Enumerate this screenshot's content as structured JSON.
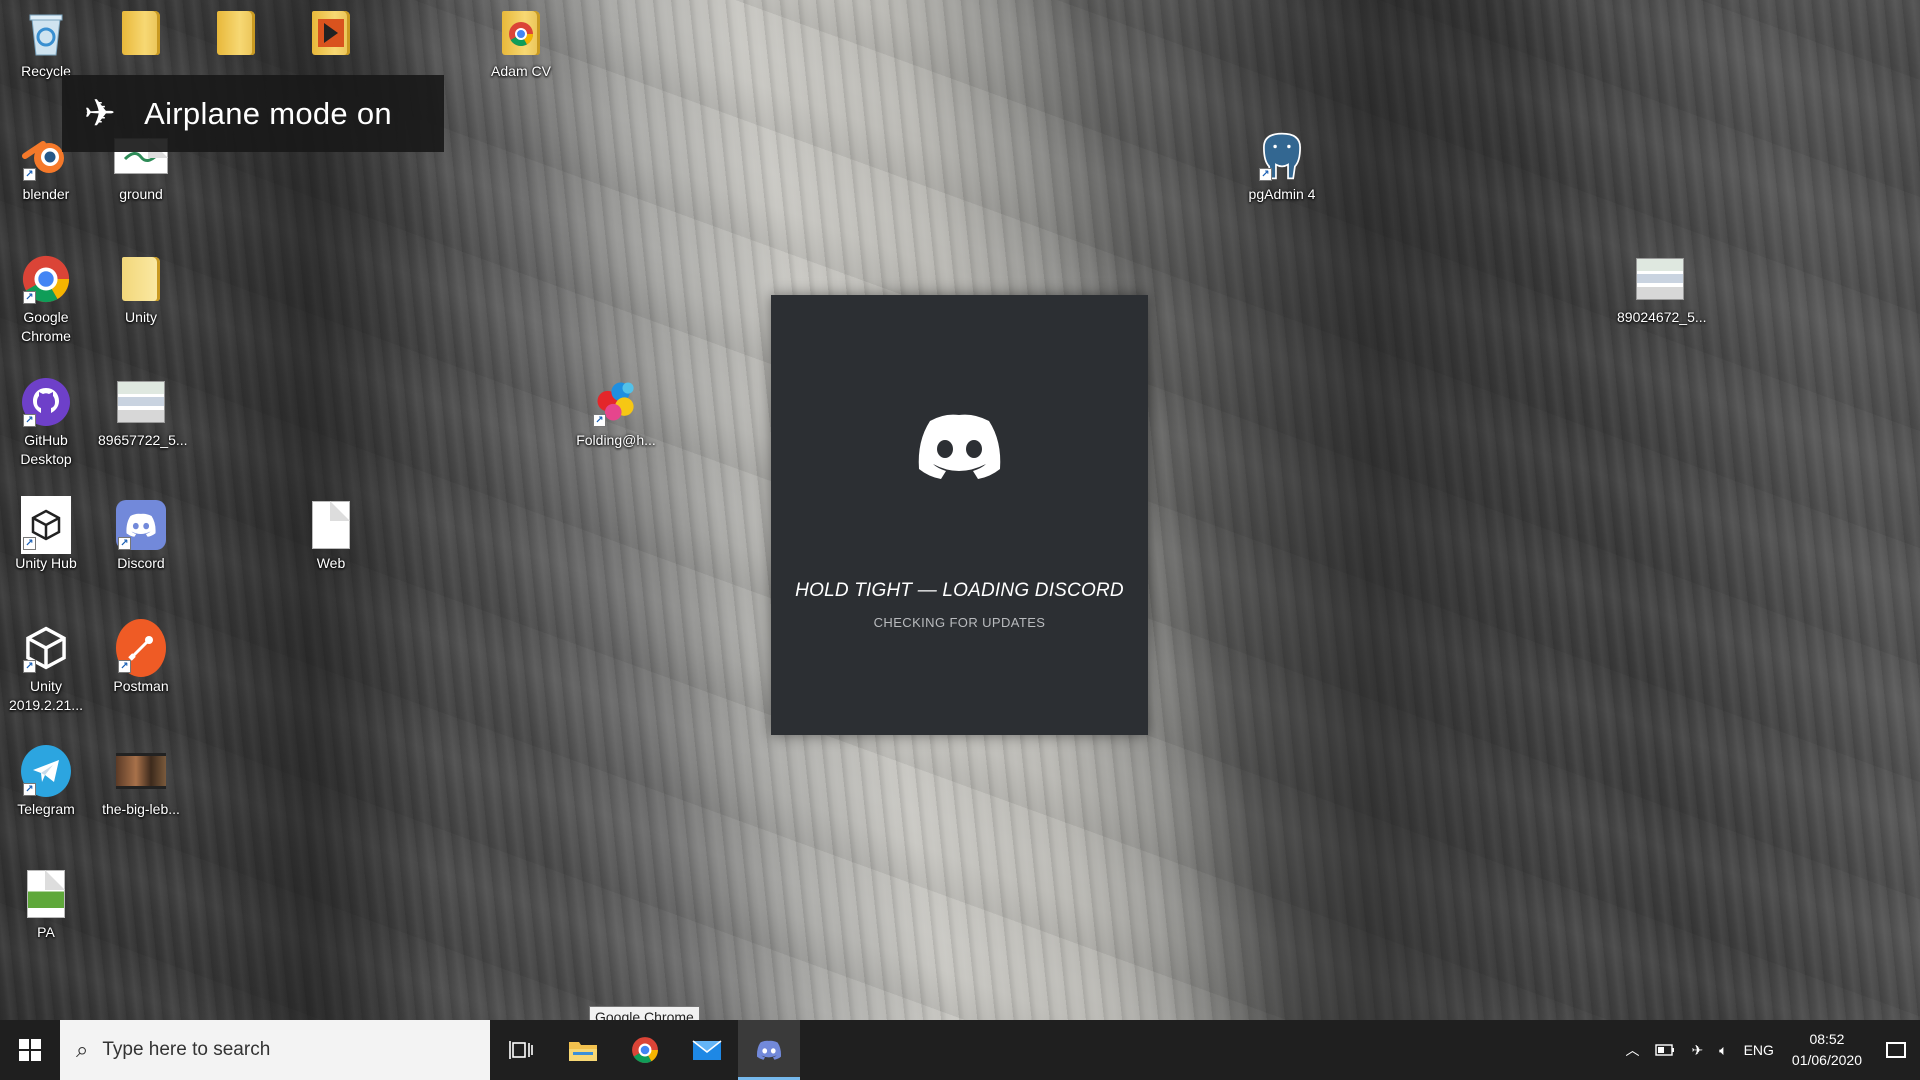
{
  "desktop": {
    "icons": [
      {
        "label": "Recycle",
        "icon": "recycle-bin-icon"
      },
      {
        "label": "",
        "icon": "folder-icon"
      },
      {
        "label": "",
        "icon": "folder-icon"
      },
      {
        "label": "",
        "icon": "folder-media-icon"
      },
      {
        "label": "Adam CV",
        "icon": "folder-chrome-icon"
      },
      {
        "label": "blender",
        "icon": "blender-icon"
      },
      {
        "label": "ground",
        "icon": "image-file-icon"
      },
      {
        "label": "pgAdmin 4",
        "icon": "pgadmin-elephant-icon"
      },
      {
        "label": "Google Chrome",
        "icon": "chrome-icon"
      },
      {
        "label": "Unity",
        "icon": "folder-icon"
      },
      {
        "label": "89024672_5...",
        "icon": "image-file-icon"
      },
      {
        "label": "GitHub Desktop",
        "icon": "github-icon"
      },
      {
        "label": "89657722_5...",
        "icon": "image-file-icon"
      },
      {
        "label": "Folding@h...",
        "icon": "folding-at-home-icon"
      },
      {
        "label": "Unity Hub",
        "icon": "unity-hub-icon"
      },
      {
        "label": "Discord",
        "icon": "discord-icon"
      },
      {
        "label": "Web",
        "icon": "blank-file-icon"
      },
      {
        "label": "Unity 2019.2.21...",
        "icon": "unity-icon"
      },
      {
        "label": "Postman",
        "icon": "postman-icon"
      },
      {
        "label": "Telegram",
        "icon": "telegram-icon"
      },
      {
        "label": "the-big-leb...",
        "icon": "video-file-icon"
      },
      {
        "label": "PA",
        "icon": "document-icon"
      }
    ]
  },
  "airplane_notification": {
    "text": "Airplane mode on",
    "icon": "airplane-icon"
  },
  "discord_splash": {
    "title": "HOLD TIGHT — LOADING DISCORD",
    "subtitle": "CHECKING FOR UPDATES",
    "background": "#2c2f33"
  },
  "tooltip": {
    "text": "Google Chrome"
  },
  "taskbar": {
    "search_placeholder": "Type here to search",
    "pinned": [
      {
        "name": "task-view",
        "icon": "task-view-icon"
      },
      {
        "name": "file-explorer",
        "icon": "file-explorer-icon"
      },
      {
        "name": "chrome",
        "icon": "chrome-icon"
      },
      {
        "name": "mail",
        "icon": "mail-icon"
      },
      {
        "name": "discord",
        "icon": "discord-icon",
        "active": true
      }
    ],
    "tray": {
      "language": "ENG",
      "time": "08:52",
      "date": "01/06/2020"
    },
    "accent": "#76b9ed"
  }
}
